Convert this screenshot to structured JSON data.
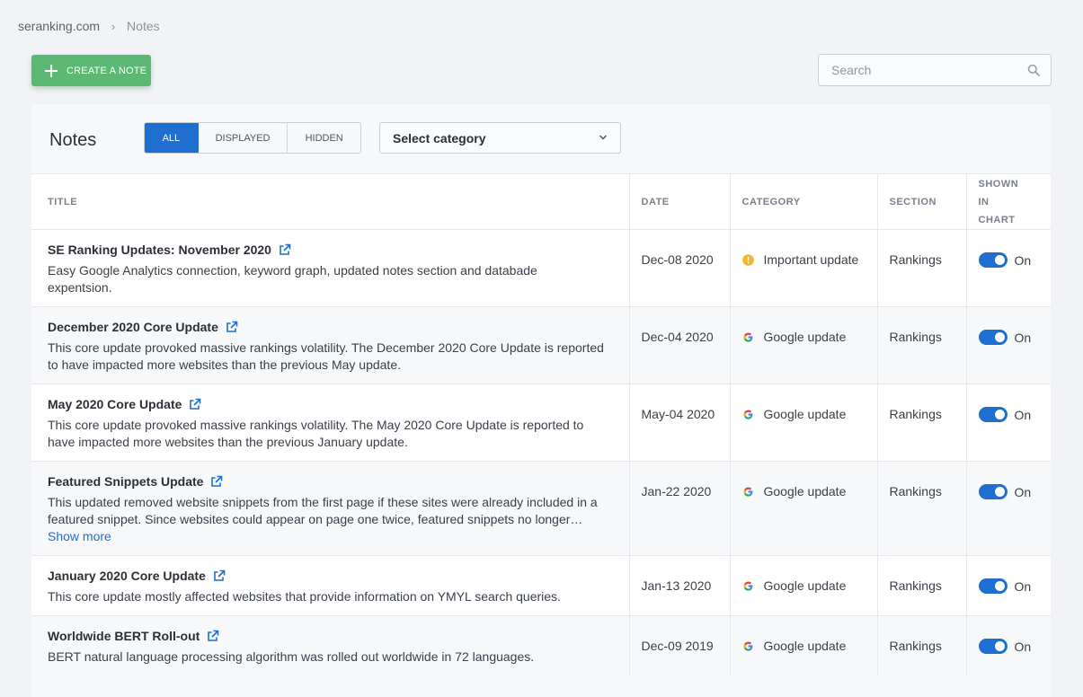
{
  "breadcrumb": {
    "root": "seranking.com",
    "separator": "›",
    "current": "Notes"
  },
  "create_button": {
    "label": "CREATE A NOTE",
    "icon": "plus-icon",
    "color": "#5bb974"
  },
  "search": {
    "placeholder": "Search",
    "value": "",
    "icon": "search-icon"
  },
  "panel": {
    "title": "Notes",
    "filter_tabs": [
      {
        "label": "ALL",
        "active": true
      },
      {
        "label": "DISPLAYED",
        "active": false
      },
      {
        "label": "HIDDEN",
        "active": false
      }
    ],
    "category_select": {
      "value": "Select category",
      "icon": "chevron-down-icon"
    }
  },
  "table": {
    "columns": {
      "title": "TITLE",
      "date": "DATE",
      "category": "CATEGORY",
      "section": "SECTION",
      "shown_line1": "SHOWN",
      "shown_line2": "IN",
      "shown_line3": "CHART"
    },
    "rows": [
      {
        "title": "SE Ranking Updates: November 2020",
        "description": "Easy Google Analytics connection, keyword graph, updated notes section and databade expentsion.",
        "date": "Dec-08 2020",
        "category": "Important update",
        "category_icon": "warning-dot-icon",
        "section": "Rankings",
        "shown": "On"
      },
      {
        "title": "December 2020 Core Update",
        "description": "This core update provoked massive rankings volatility. The December 2020 Core Update is reported to have impacted more websites than the previous May update.",
        "date": "Dec-04 2020",
        "category": "Google update",
        "category_icon": "google-icon",
        "section": "Rankings",
        "shown": "On"
      },
      {
        "title": "May 2020 Core Update",
        "description": "This core update provoked massive rankings volatility. The May 2020 Core Update is reported to have impacted more websites than the previous January update.",
        "date": "May-04 2020",
        "category": "Google update",
        "category_icon": "google-icon",
        "section": "Rankings",
        "shown": "On"
      },
      {
        "title": "Featured Snippets Update",
        "description": "This updated removed website snippets from the first page if these sites were already included in a featured snippet. Since websites could appear on page one twice, featured snippets no longer had...",
        "show_more": "Show more",
        "date": "Jan-22 2020",
        "category": "Google update",
        "category_icon": "google-icon",
        "section": "Rankings",
        "shown": "On"
      },
      {
        "title": "January 2020 Core Update",
        "description": "This core update mostly affected websites that provide information on YMYL search queries.",
        "date": "Jan-13 2020",
        "category": "Google update",
        "category_icon": "google-icon",
        "section": "Rankings",
        "shown": "On"
      },
      {
        "title": "Worldwide BERT Roll-out",
        "description": "BERT natural language processing algorithm was rolled out worldwide in 72 languages.",
        "date": "Dec-09 2019",
        "category": "Google update",
        "category_icon": "google-icon",
        "section": "Rankings",
        "shown": "On"
      }
    ]
  },
  "colors": {
    "accent_blue": "#1f6fd1",
    "green": "#5bb974",
    "warning": "#f2b529"
  }
}
